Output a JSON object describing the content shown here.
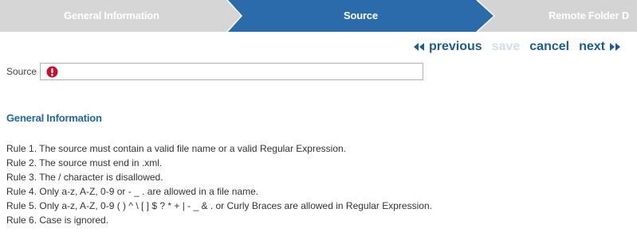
{
  "wizard": {
    "steps": [
      {
        "label": "General Information",
        "state": "done"
      },
      {
        "label": "Source",
        "state": "active"
      },
      {
        "label": "Remote Folder D",
        "state": "pending"
      }
    ],
    "colors": {
      "inactive": "#d5d5d5",
      "active": "#2c6ba9"
    }
  },
  "nav": {
    "previous": "previous",
    "save": "save",
    "cancel": "cancel",
    "next": "next",
    "previous_icon": "double-left-arrow-icon",
    "next_icon": "double-right-arrow-icon"
  },
  "form": {
    "source_label": "Source",
    "source_value": "",
    "error_icon": "error-exclamation-icon"
  },
  "info": {
    "title": "General Information",
    "rules": [
      "Rule 1. The source must contain a valid file name or a valid Regular Expression.",
      "Rule 2. The source must end in .xml.",
      "Rule 3. The / character is disallowed.",
      "Rule 4. Only a-z, A-Z, 0-9 or - _ . are allowed in a file name.",
      "Rule 5. Only a-z, A-Z, 0-9 ( ) ^ \\ [ ] $ ? * + | - _ & . or Curly Braces are allowed in Regular Expression.",
      "Rule 6. Case is ignored."
    ]
  }
}
